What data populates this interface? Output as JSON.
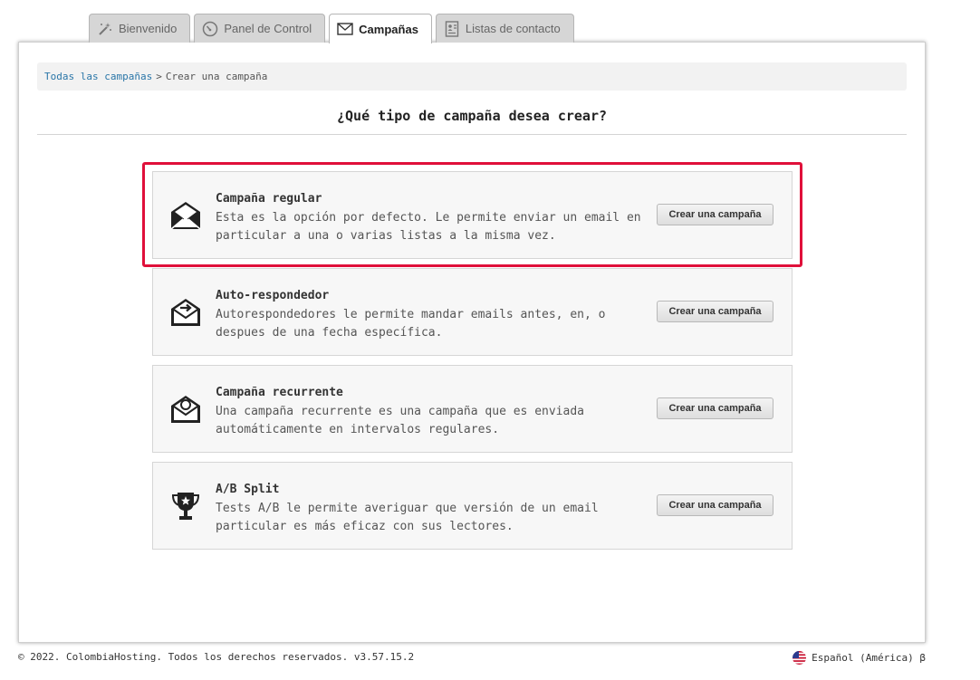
{
  "tabs": [
    {
      "label": "Bienvenido",
      "icon": "magic-wand-icon",
      "active": false
    },
    {
      "label": "Panel de Control",
      "icon": "dashboard-gauge-icon",
      "active": false
    },
    {
      "label": "Campañas",
      "icon": "envelope-icon",
      "active": true
    },
    {
      "label": "Listas de contacto",
      "icon": "contact-list-icon",
      "active": false
    }
  ],
  "breadcrumb": {
    "root": "Todas las campañas",
    "separator": ">",
    "current": "Crear una campaña"
  },
  "page": {
    "title": "¿Qué tipo de campaña desea crear?"
  },
  "options": [
    {
      "title": "Campaña regular",
      "description": "Esta es la opción por defecto. Le permite enviar un email en particular a una o varias listas a la misma vez.",
      "button": "Crear una campaña",
      "icon": "open-envelope-icon"
    },
    {
      "title": "Auto-respondedor",
      "description": "Autorespondedores le permite mandar emails antes, en, o despues de una fecha específica.",
      "button": "Crear una campaña",
      "icon": "envelope-arrow-icon"
    },
    {
      "title": "Campaña recurrente",
      "description": "Una campaña recurrente es una campaña que es enviada automáticamente en intervalos regulares.",
      "button": "Crear una campaña",
      "icon": "envelope-recurring-icon"
    },
    {
      "title": "A/B Split",
      "description": "Tests A/B le permite averiguar que versión de un email particular es más eficaz con sus lectores.",
      "button": "Crear una campaña",
      "icon": "trophy-icon"
    }
  ],
  "footer": {
    "copyright": "© 2022. ColombiaHosting. Todos los derechos reservados. v3.57.15.2",
    "language": "Español (América) β",
    "language_icon": "us-flag-icon"
  },
  "colors": {
    "highlight": "#e0103a",
    "link": "#2a76a8"
  }
}
